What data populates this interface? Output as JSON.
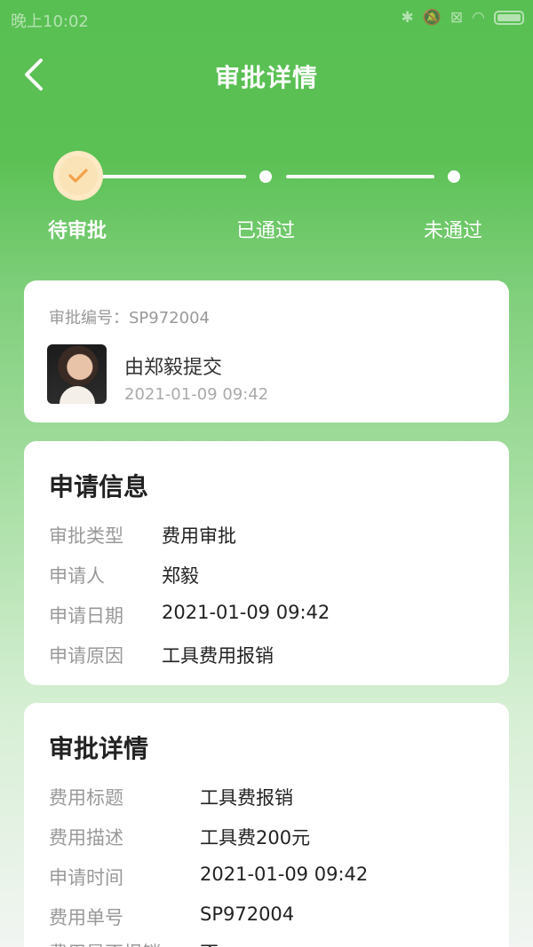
{
  "status": {
    "time": "晚上10:02"
  },
  "nav": {
    "title": "审批详情"
  },
  "steps": [
    {
      "label": "待审批",
      "state": "current"
    },
    {
      "label": "已通过",
      "state": "pending"
    },
    {
      "label": "未通过",
      "state": "pending"
    }
  ],
  "summary": {
    "approval_no": "审批编号：SP972004",
    "submitter": "由郑毅提交",
    "time": "2021-01-09 09:42"
  },
  "apply_info": {
    "title": "申请信息",
    "rows": [
      {
        "key": "审批类型",
        "value": "费用审批"
      },
      {
        "key": "申请人",
        "value": "郑毅"
      },
      {
        "key": "申请日期",
        "value": "2021-01-09 09:42"
      },
      {
        "key": "申请原因",
        "value": "工具费用报销"
      }
    ]
  },
  "approval_detail": {
    "title": "审批详情",
    "rows": [
      {
        "key": "费用标题",
        "value": "工具费报销"
      },
      {
        "key": "费用描述",
        "value": "工具费200元"
      },
      {
        "key": "申请时间",
        "value": "2021-01-09 09:42"
      },
      {
        "key": "费用单号",
        "value": "SP972004"
      },
      {
        "key": "费用是否报销",
        "value": "否"
      }
    ]
  },
  "colors": {
    "primary": "#5cc155",
    "step_current": "#fde9c4",
    "check": "#f2a24a"
  }
}
